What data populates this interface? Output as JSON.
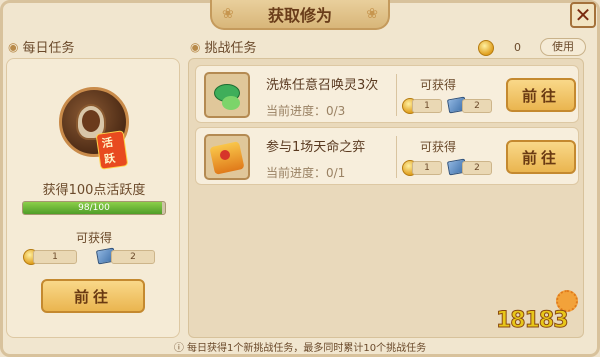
{
  "header": {
    "title": "获取修为",
    "close_symbol": "✕"
  },
  "currency": {
    "value": "0",
    "use_label": "使用"
  },
  "daily": {
    "section_label": "每日任务",
    "icon_badge": "活跃",
    "reward_text": "获得100点活跃度",
    "progress_text": "98/100",
    "progress_fraction": 0.98,
    "available_label": "可获得",
    "rewards": {
      "coin": "1",
      "book": "2"
    },
    "go_label": "前往"
  },
  "challenge": {
    "section_label": "挑战任务",
    "tasks": [
      {
        "name": "洗炼任意召唤灵3次",
        "progress": "当前进度：0/3",
        "available_label": "可获得",
        "coin": "1",
        "book": "2",
        "go_label": "前往"
      },
      {
        "name": "参与1场天命之弈",
        "progress": "当前进度：0/1",
        "available_label": "可获得",
        "coin": "1",
        "book": "2",
        "go_label": "前往"
      }
    ]
  },
  "footer": {
    "text": "每日获得1个新挑战任务，最多同时累计10个挑战任务"
  },
  "watermark": {
    "text": "18183"
  }
}
